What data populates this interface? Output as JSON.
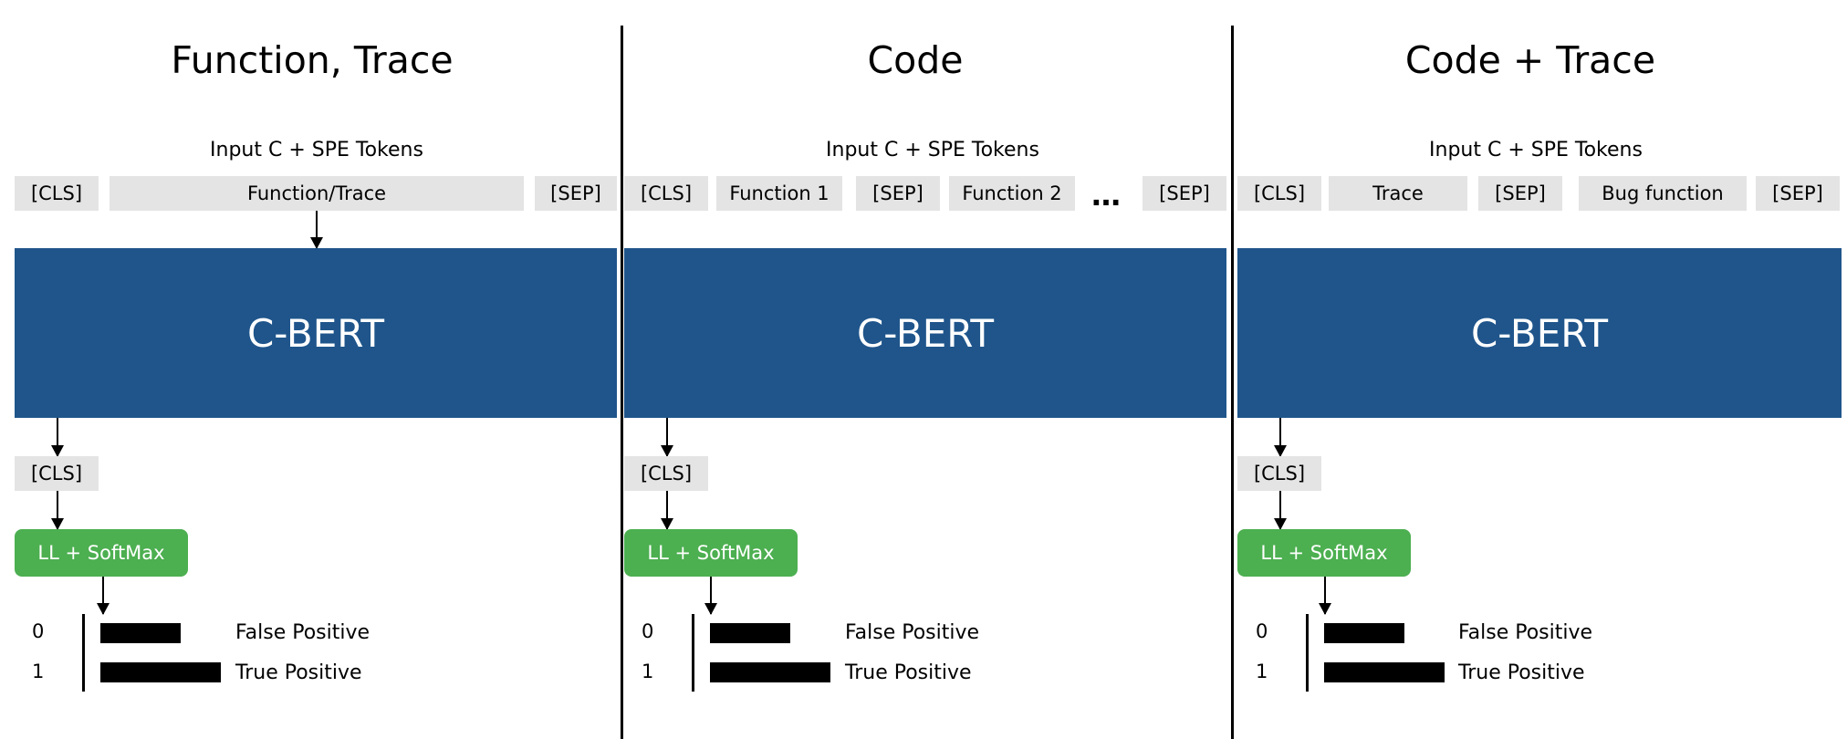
{
  "panels": [
    {
      "title": "Function, Trace",
      "input_label": "Input C + SPE Tokens",
      "tokens": [
        "[CLS]",
        "Function/Trace",
        "[SEP]"
      ],
      "model": "C-BERT",
      "cls_output": "[CLS]",
      "head": "LL + SoftMax",
      "outputs": [
        {
          "index": "0",
          "label": "False Positive",
          "value": 0.4
        },
        {
          "index": "1",
          "label": "True Positive",
          "value": 0.6
        }
      ]
    },
    {
      "title": "Code",
      "input_label": "Input C + SPE Tokens",
      "tokens": [
        "[CLS]",
        "Function 1",
        "[SEP]",
        "Function 2",
        "…",
        "[SEP]"
      ],
      "model": "C-BERT",
      "cls_output": "[CLS]",
      "head": "LL + SoftMax",
      "outputs": [
        {
          "index": "0",
          "label": "False Positive",
          "value": 0.4
        },
        {
          "index": "1",
          "label": "True Positive",
          "value": 0.6
        }
      ]
    },
    {
      "title": "Code + Trace",
      "input_label": "Input C + SPE Tokens",
      "tokens": [
        "[CLS]",
        "Trace",
        "[SEP]",
        "Bug function",
        "[SEP]"
      ],
      "model": "C-BERT",
      "cls_output": "[CLS]",
      "head": "LL + SoftMax",
      "outputs": [
        {
          "index": "0",
          "label": "False Positive",
          "value": 0.4
        },
        {
          "index": "1",
          "label": "True Positive",
          "value": 0.6
        }
      ]
    }
  ],
  "colors": {
    "model": "#1f558b",
    "head": "#4caf50",
    "token_bg": "#e4e4e4"
  }
}
